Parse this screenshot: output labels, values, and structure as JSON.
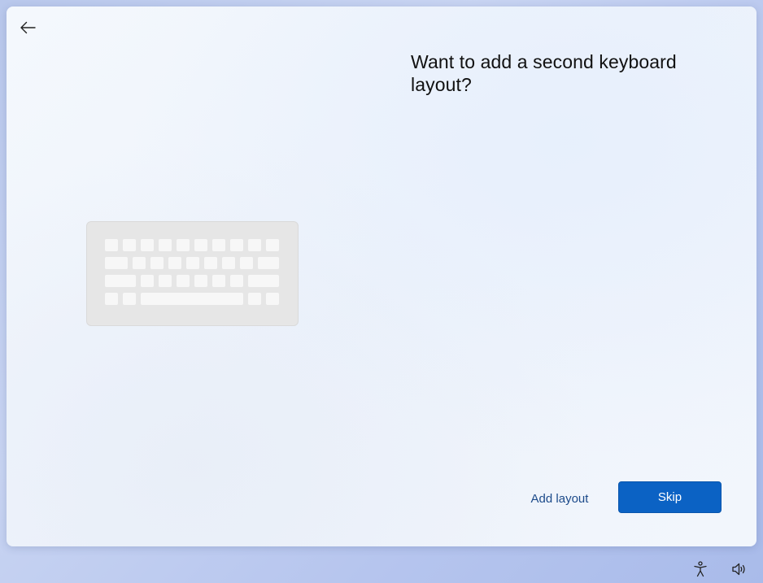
{
  "heading": "Want to add a second keyboard layout?",
  "actions": {
    "add_layout_label": "Add layout",
    "skip_label": "Skip"
  },
  "icons": {
    "back": "arrow-left-icon",
    "illustration": "keyboard-icon",
    "accessibility": "accessibility-icon",
    "volume": "volume-icon"
  },
  "colors": {
    "primary_button": "#0b62c4",
    "link": "#1c4a8a"
  }
}
